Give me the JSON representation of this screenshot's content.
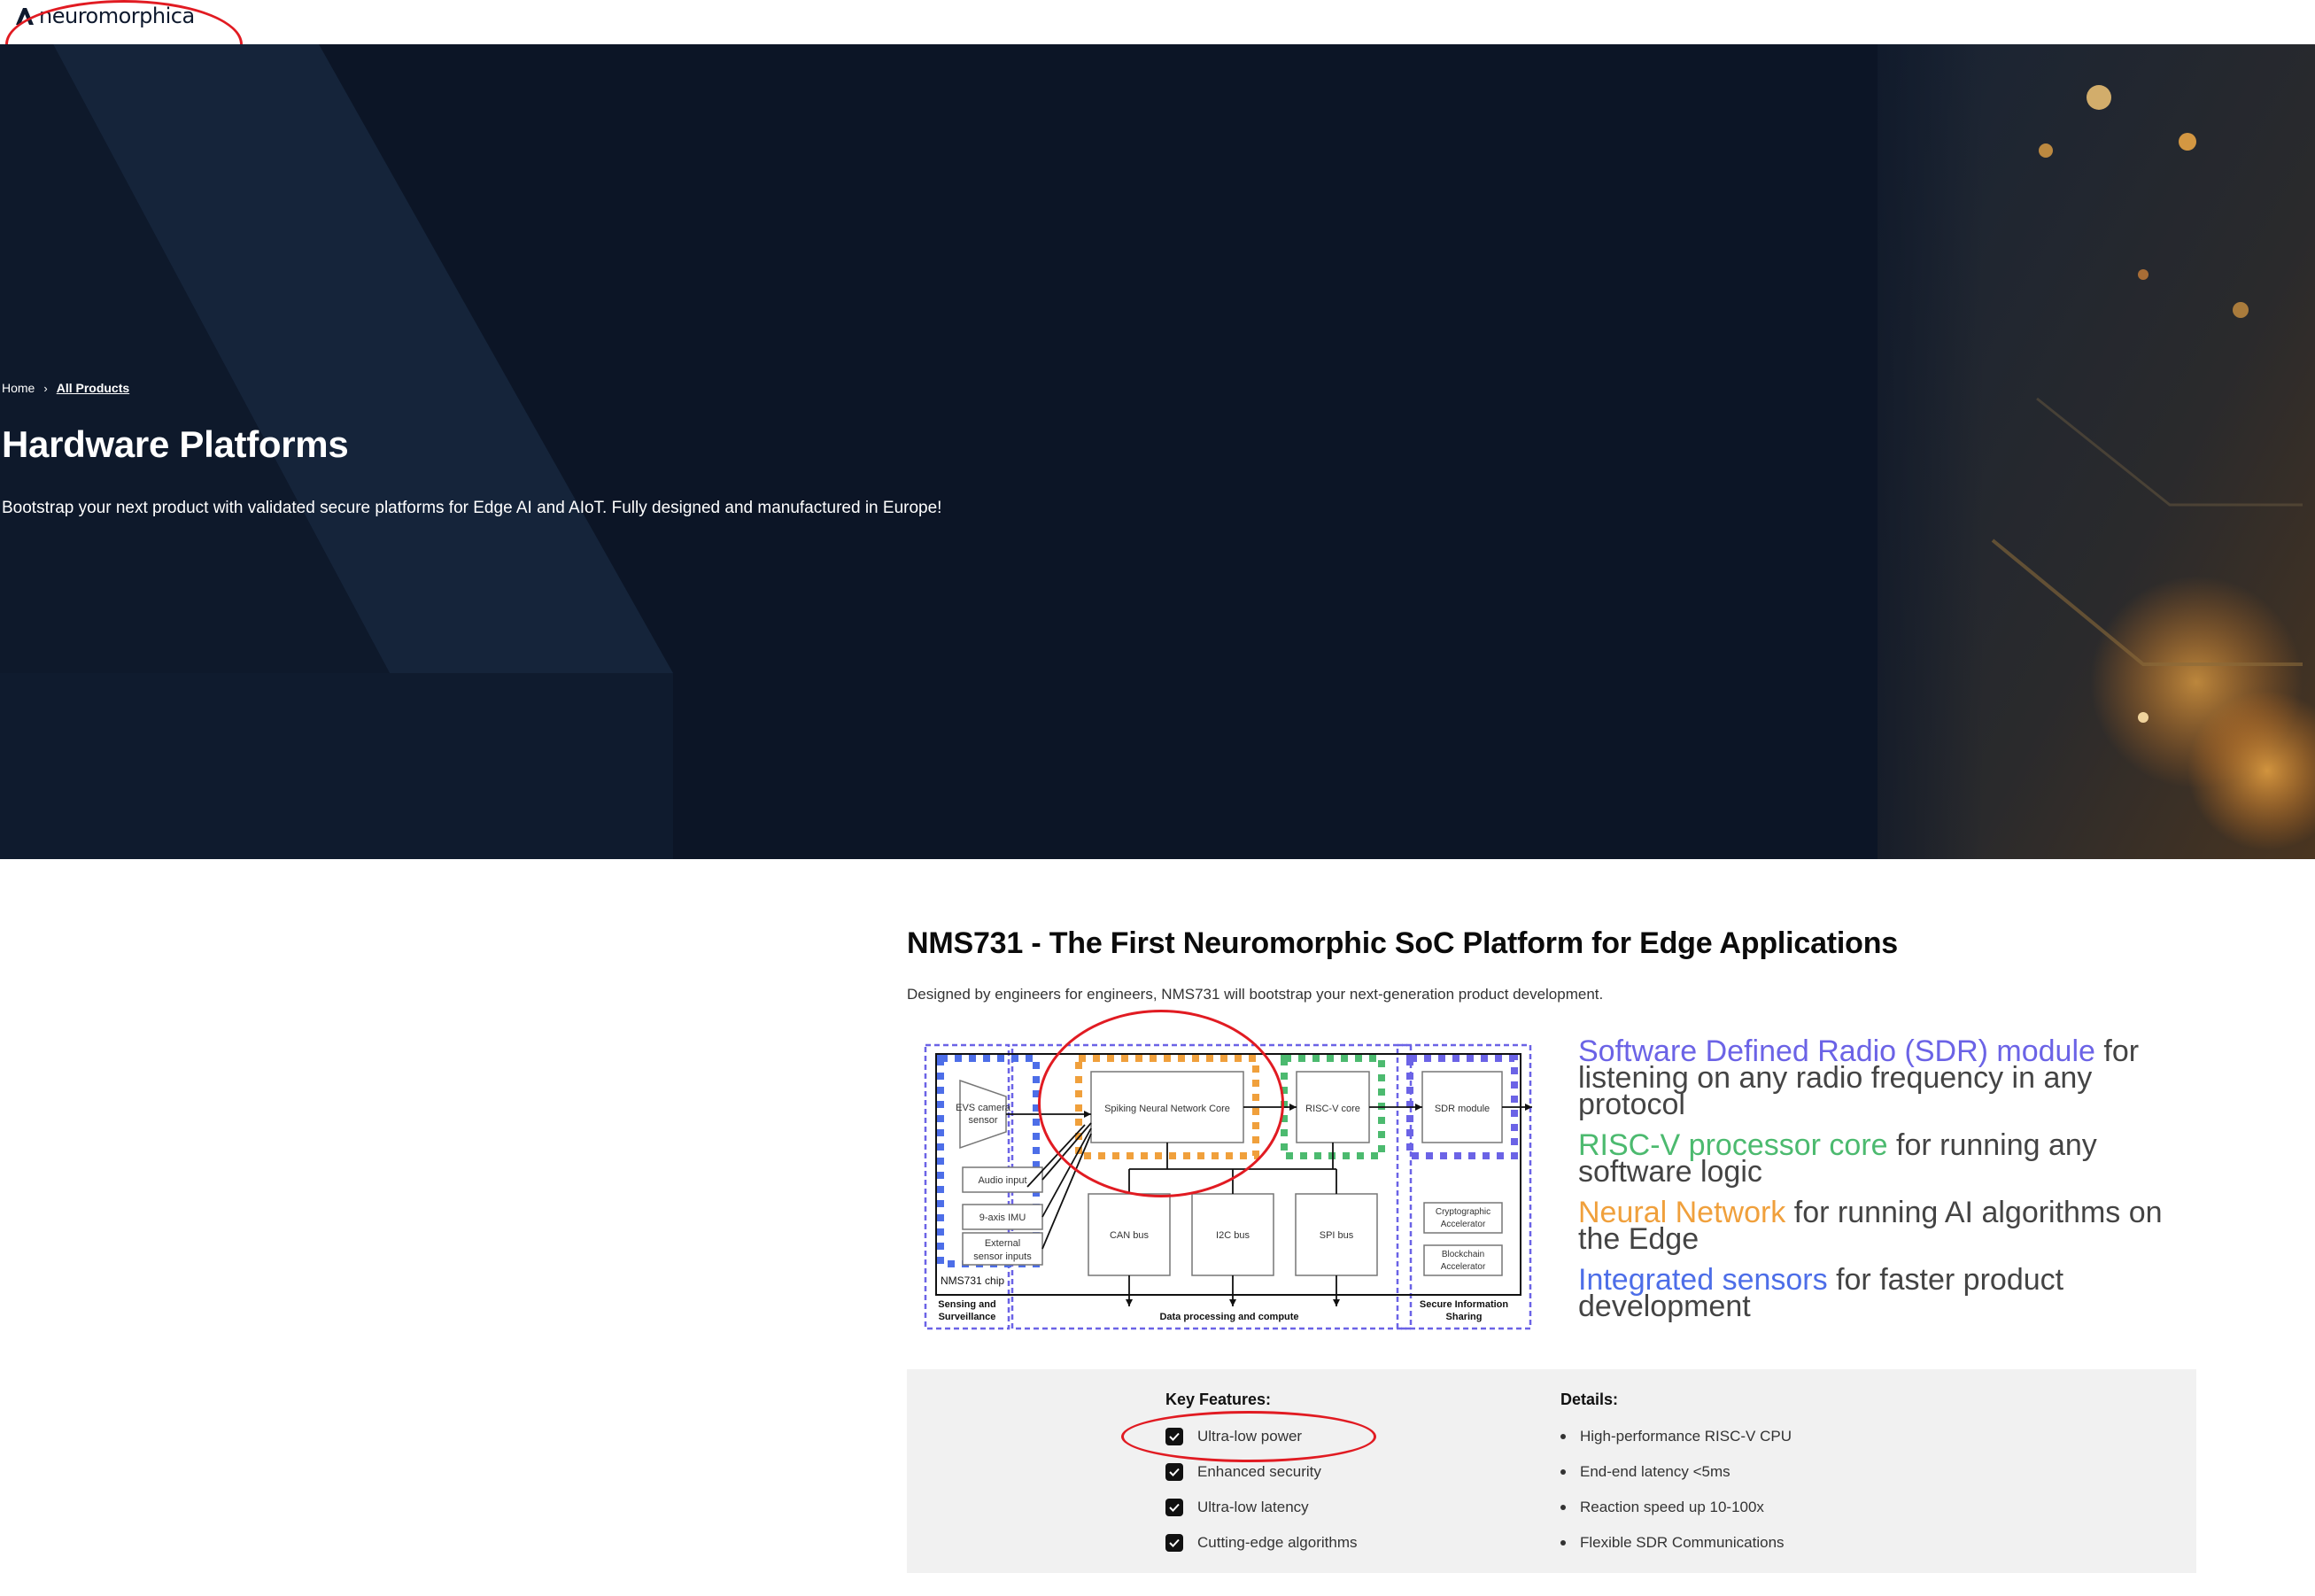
{
  "header": {
    "logo_text": "neuromorphica"
  },
  "hero": {
    "breadcrumb": {
      "home": "Home",
      "current": "All Products"
    },
    "title": "Hardware Platforms",
    "subtitle": "Bootstrap your next product with validated secure platforms for Edge AI and AIoT. Fully designed and manufactured in Europe!"
  },
  "product": {
    "title": "NMS731 - The First Neuromorphic SoC Platform for Edge Applications",
    "subtitle": "Designed by engineers for engineers, NMS731 will bootstrap your next-generation product development.",
    "diagram": {
      "evs": [
        "EVS camera",
        "sensor"
      ],
      "audio": "Audio input",
      "imu": "9-axis IMU",
      "external": [
        "External",
        "sensor inputs"
      ],
      "chip": "NMS731 chip",
      "snn": "Spiking Neural Network Core",
      "riscv": "RISC-V core",
      "sdr": "SDR module",
      "can": "CAN bus",
      "i2c": "I2C bus",
      "spi": "SPI bus",
      "crypto": [
        "Cryptographic",
        "Accelerator"
      ],
      "blockchain": [
        "Blockchain",
        "Accelerator"
      ],
      "sensing_label": [
        "Sensing and",
        "Surveillance"
      ],
      "data_label": "Data processing and compute",
      "secure_label": [
        "Secure Information",
        "Sharing"
      ]
    },
    "features": [
      {
        "highlight": "Software Defined Radio (SDR) module",
        "rest": " for listening on any radio frequency in any protocol",
        "color": "#6b63e6"
      },
      {
        "highlight": "RISC-V processor core",
        "rest": " for running any software logic",
        "color": "#4cba6f"
      },
      {
        "highlight": "Neural Network",
        "rest": " for running AI algorithms on the Edge",
        "color": "#f0a03c"
      },
      {
        "highlight": "Integrated sensors",
        "rest": " for faster product development",
        "color": "#4d6ee8"
      }
    ]
  },
  "panel": {
    "key_features_title": "Key Features:",
    "key_features": [
      "Ultra-low power",
      "Enhanced security",
      "Ultra-low latency",
      "Cutting-edge algorithms"
    ],
    "details_title": "Details:",
    "details": [
      "High-performance RISC-V CPU",
      "End-end latency <5ms",
      "Reaction speed up 10-100x",
      "Flexible SDR Communications"
    ]
  },
  "colors": {
    "hero_bg": "#0c1526",
    "annotation": "#e11b22",
    "panel_bg": "#f1f1f1"
  }
}
